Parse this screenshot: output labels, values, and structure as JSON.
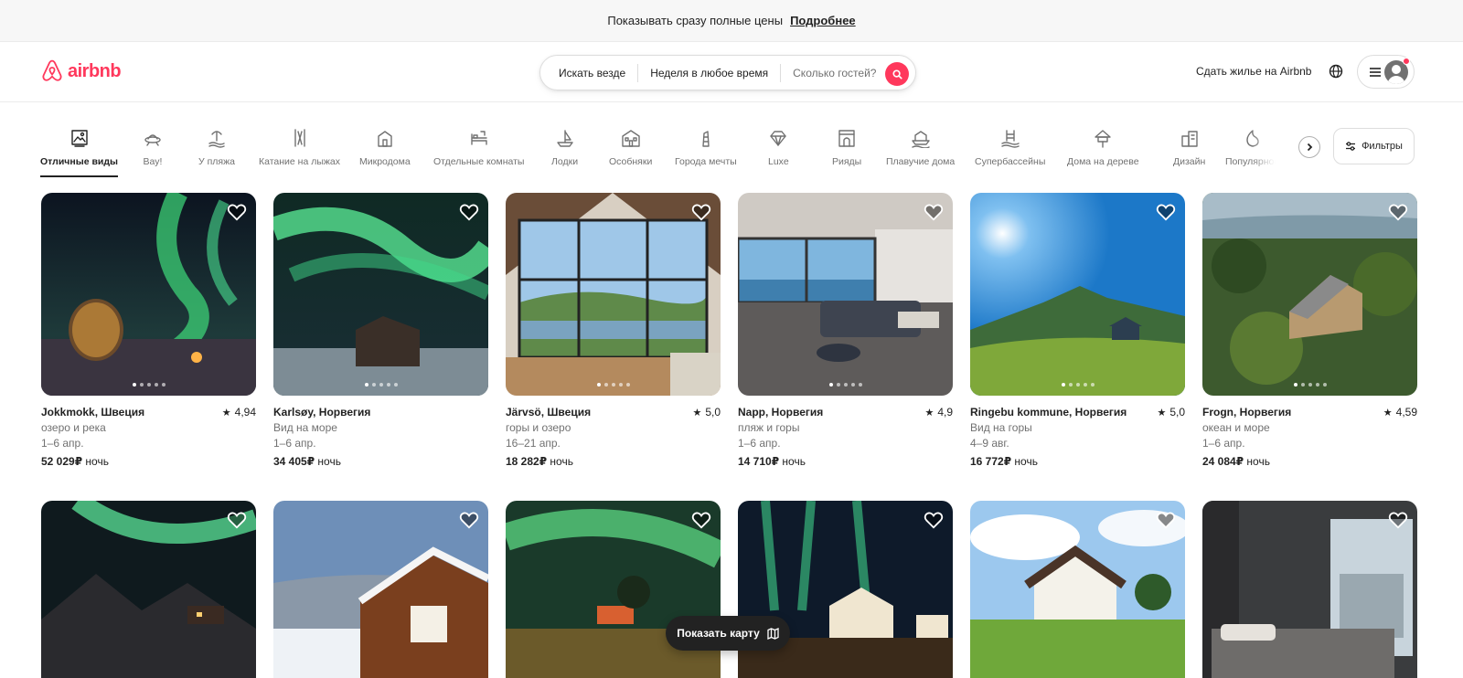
{
  "banner": {
    "text": "Показывать сразу полные цены",
    "link": "Подробнее"
  },
  "header": {
    "logo_text": "airbnb",
    "search": {
      "where": "Искать везде",
      "when": "Неделя в любое время",
      "guests_placeholder": "Сколько гостей?"
    },
    "host_link": "Сдать жилье на Airbnb"
  },
  "categories": [
    {
      "label": "Отличные виды",
      "icon": "frame-icon",
      "active": true
    },
    {
      "label": "Вау!",
      "icon": "ufo-icon"
    },
    {
      "label": "У пляжа",
      "icon": "beach-icon"
    },
    {
      "label": "Катание на лыжах",
      "icon": "ski-icon"
    },
    {
      "label": "Микродома",
      "icon": "tiny-home-icon"
    },
    {
      "label": "Отдельные комнаты",
      "icon": "bed-icon"
    },
    {
      "label": "Лодки",
      "icon": "boat-icon"
    },
    {
      "label": "Особняки",
      "icon": "mansion-icon"
    },
    {
      "label": "Города мечты",
      "icon": "tower-icon"
    },
    {
      "label": "Luxe",
      "icon": "diamond-icon"
    },
    {
      "label": "Рияды",
      "icon": "riad-icon"
    },
    {
      "label": "Плавучие дома",
      "icon": "houseboat-icon"
    },
    {
      "label": "Супербассейны",
      "icon": "pool-icon"
    },
    {
      "label": "Дома на дереве",
      "icon": "treehouse-icon"
    },
    {
      "label": "Дизайн",
      "icon": "design-icon"
    },
    {
      "label": "Популярное",
      "icon": "flame-icon"
    }
  ],
  "filters_label": "Фильтры",
  "listings": [
    {
      "title": "Jokkmokk, Швеция",
      "rating": "4,94",
      "line1": "озеро и река",
      "dates": "1–6 апр.",
      "price": "52 029₽",
      "per": "ночь"
    },
    {
      "title": "Karlsøy, Норвегия",
      "rating": "",
      "line1": "Вид на море",
      "dates": "1–6 апр.",
      "price": "34 405₽",
      "per": "ночь"
    },
    {
      "title": "Järvsö, Швеция",
      "rating": "5,0",
      "line1": "горы и озеро",
      "dates": "16–21 апр.",
      "price": "18 282₽",
      "per": "ночь"
    },
    {
      "title": "Napp, Норвегия",
      "rating": "4,9",
      "line1": "пляж и горы",
      "dates": "1–6 апр.",
      "price": "14 710₽",
      "per": "ночь"
    },
    {
      "title": "Ringebu kommune, Норвегия",
      "rating": "5,0",
      "line1": "Вид на горы",
      "dates": "4–9 авг.",
      "price": "16 772₽",
      "per": "ночь"
    },
    {
      "title": "Frogn, Норвегия",
      "rating": "4,59",
      "line1": "океан и море",
      "dates": "1–6 апр.",
      "price": "24 084₽",
      "per": "ночь"
    }
  ],
  "map_button": "Показать карту",
  "colors": {
    "brand": "#ff385c",
    "text": "#222222",
    "muted": "#717171",
    "border": "#dddddd"
  }
}
